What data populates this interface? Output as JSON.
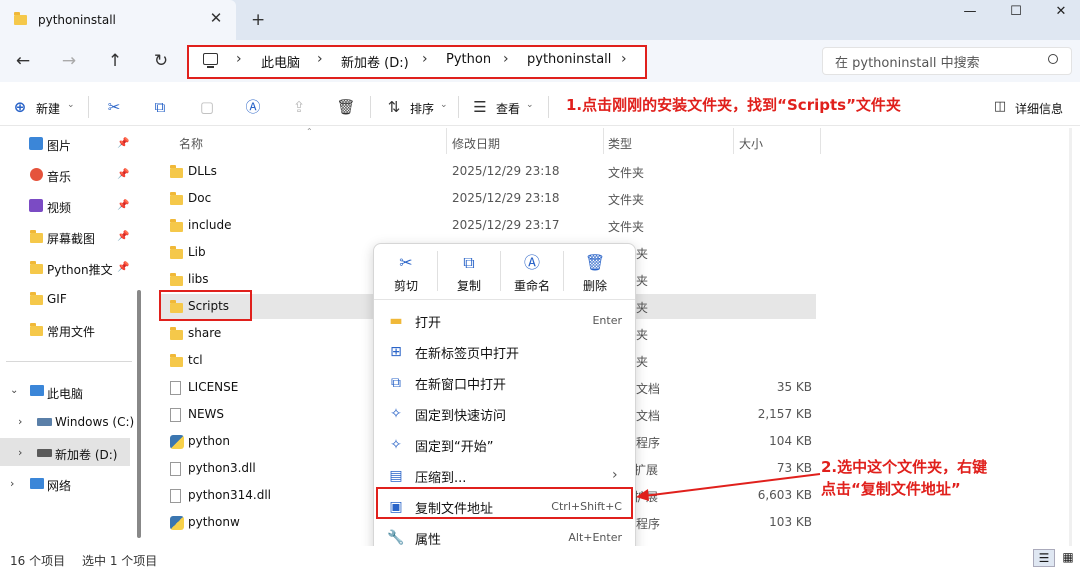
{
  "window": {
    "tab_title": "pythoninstall",
    "tab_close": "✕",
    "new_tab": "+",
    "minimize": "—",
    "maximize": "☐",
    "close": "✕"
  },
  "nav_buttons": {
    "back": "←",
    "forward": "→",
    "up": "↑",
    "refresh": "↻"
  },
  "breadcrumb": {
    "items": [
      "此电脑",
      "新加卷 (D:)",
      "Python",
      "pythoninstall"
    ],
    "separator": "›"
  },
  "search": {
    "placeholder": "在 pythoninstall 中搜索"
  },
  "toolbar": {
    "new_label": "新建",
    "sort_label": "排序",
    "view_label": "查看",
    "more_label": "···",
    "details_label": "详细信息"
  },
  "annotations": {
    "step1": "1.点击刚刚的安装文件夹，找到“Scripts”文件夹",
    "step2_line1": "2.选中这个文件夹，右键",
    "step2_line2": "点击“复制文件地址”",
    "color": "#e0201c"
  },
  "sidebar": {
    "quick_access": [
      {
        "label": "图片",
        "icon": "image-icon"
      },
      {
        "label": "音乐",
        "icon": "music-icon"
      },
      {
        "label": "视频",
        "icon": "video-icon"
      },
      {
        "label": "屏幕截图",
        "icon": "folder-icon"
      },
      {
        "label": "Python推文",
        "icon": "folder-icon"
      },
      {
        "label": "GIF",
        "icon": "folder-icon"
      },
      {
        "label": "常用文件",
        "icon": "folder-icon"
      }
    ],
    "tree": [
      {
        "label": "此电脑",
        "icon": "computer-icon"
      },
      {
        "label": "Windows (C:)",
        "icon": "drive-icon"
      },
      {
        "label": "新加卷 (D:)",
        "icon": "drive-icon"
      },
      {
        "label": "网络",
        "icon": "network-icon"
      }
    ]
  },
  "columns": {
    "name": "名称",
    "date": "修改日期",
    "type": "类型",
    "size": "大小"
  },
  "files": [
    {
      "name": "DLLs",
      "date": "2025/12/29 23:18",
      "type": "文件夹",
      "size": "",
      "icon": "folder"
    },
    {
      "name": "Doc",
      "date": "2025/12/29 23:18",
      "type": "文件夹",
      "size": "",
      "icon": "folder"
    },
    {
      "name": "include",
      "date": "2025/12/29 23:17",
      "type": "文件夹",
      "size": "",
      "icon": "folder"
    },
    {
      "name": "Lib",
      "date": "",
      "type": "夹",
      "size": "",
      "icon": "folder"
    },
    {
      "name": "libs",
      "date": "",
      "type": "夹",
      "size": "",
      "icon": "folder"
    },
    {
      "name": "Scripts",
      "date": "",
      "type": "夹",
      "size": "",
      "icon": "folder"
    },
    {
      "name": "share",
      "date": "",
      "type": "夹",
      "size": "",
      "icon": "folder"
    },
    {
      "name": "tcl",
      "date": "",
      "type": "夹",
      "size": "",
      "icon": "folder"
    },
    {
      "name": "LICENSE",
      "date": "",
      "type": "文档",
      "size": "35 KB",
      "icon": "file"
    },
    {
      "name": "NEWS",
      "date": "",
      "type": "文档",
      "size": "2,157 KB",
      "icon": "file"
    },
    {
      "name": "python",
      "date": "",
      "type": "程序",
      "size": "104 KB",
      "icon": "py"
    },
    {
      "name": "python3.dll",
      "date": "",
      "type": "程序扩展",
      "size": "73 KB",
      "icon": "file"
    },
    {
      "name": "python314.dll",
      "date": "",
      "type": "程序扩展",
      "size": "6,603 KB",
      "icon": "file"
    },
    {
      "name": "pythonw",
      "date": "",
      "type": "程序",
      "size": "103 KB",
      "icon": "py"
    }
  ],
  "context_menu": {
    "quick": [
      {
        "label": "剪切",
        "icon": "scissors-icon",
        "glyph": "✂"
      },
      {
        "label": "复制",
        "icon": "copy-icon",
        "glyph": "⧉"
      },
      {
        "label": "重命名",
        "icon": "rename-icon",
        "glyph": "Ⓐ"
      },
      {
        "label": "删除",
        "icon": "trash-icon",
        "glyph": "🗑"
      }
    ],
    "items": [
      {
        "label": "打开",
        "shortcut": "Enter",
        "icon": "folder-open-icon",
        "glyph": "▬"
      },
      {
        "label": "在新标签页中打开",
        "shortcut": "",
        "icon": "new-tab-icon",
        "glyph": "⊞"
      },
      {
        "label": "在新窗口中打开",
        "shortcut": "",
        "icon": "new-window-icon",
        "glyph": "⧉"
      },
      {
        "label": "固定到快速访问",
        "shortcut": "",
        "icon": "pin-icon",
        "glyph": "✧"
      },
      {
        "label": "固定到“开始”",
        "shortcut": "",
        "icon": "pin-start-icon",
        "glyph": "✧"
      },
      {
        "label": "压缩到...",
        "shortcut": "›",
        "icon": "zip-icon",
        "glyph": "▤"
      },
      {
        "label": "复制文件地址",
        "shortcut": "Ctrl+Shift+C",
        "icon": "copy-path-icon",
        "glyph": "▣"
      },
      {
        "label": "属性",
        "shortcut": "Alt+Enter",
        "icon": "wrench-icon",
        "glyph": "🔧"
      }
    ]
  },
  "status": {
    "count": "16 个项目",
    "selected": "选中 1 个项目"
  }
}
